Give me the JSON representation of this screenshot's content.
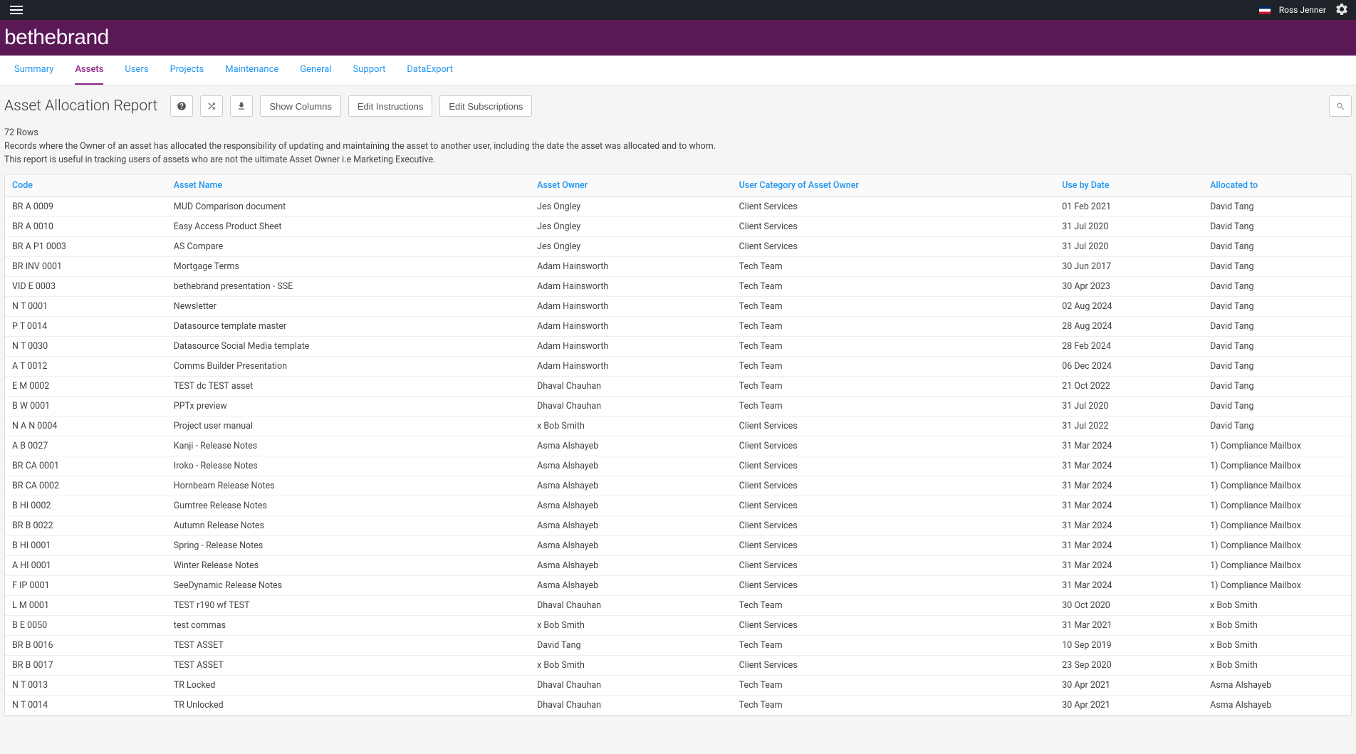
{
  "topbar": {
    "user_name": "Ross Jenner"
  },
  "brand": {
    "logo_text_1": "be",
    "logo_text_2": "the",
    "logo_text_3": "brand"
  },
  "tabs": [
    {
      "label": "Summary",
      "active": false
    },
    {
      "label": "Assets",
      "active": true
    },
    {
      "label": "Users",
      "active": false
    },
    {
      "label": "Projects",
      "active": false
    },
    {
      "label": "Maintenance",
      "active": false
    },
    {
      "label": "General",
      "active": false
    },
    {
      "label": "Support",
      "active": false
    },
    {
      "label": "DataExport",
      "active": false
    }
  ],
  "page": {
    "title": "Asset Allocation Report",
    "btn_show_columns": "Show Columns",
    "btn_edit_instructions": "Edit Instructions",
    "btn_edit_subscriptions": "Edit Subscriptions"
  },
  "meta": {
    "row_count": "72 Rows",
    "desc_line1": "Records where the Owner of an asset has allocated the responsibility of updating and maintaining the asset to another user, including the date the asset was allocated and to whom.",
    "desc_line2": "This report is useful in tracking users of assets who are not the ultimate Asset Owner i.e Marketing Executive."
  },
  "table": {
    "headers": {
      "code": "Code",
      "asset_name": "Asset Name",
      "asset_owner": "Asset Owner",
      "user_category": "User Category of Asset Owner",
      "use_by_date": "Use by Date",
      "allocated_to": "Allocated to"
    },
    "rows": [
      {
        "code": "BR A 0009",
        "name": "MUD Comparison document",
        "owner": "Jes Ongley",
        "category": "Client Services",
        "date": "01 Feb 2021",
        "allocated": "David Tang"
      },
      {
        "code": "BR A 0010",
        "name": "Easy Access Product Sheet",
        "owner": "Jes Ongley",
        "category": "Client Services",
        "date": "31 Jul 2020",
        "allocated": "David Tang"
      },
      {
        "code": "BR A P1 0003",
        "name": "AS Compare",
        "owner": "Jes Ongley",
        "category": "Client Services",
        "date": "31 Jul 2020",
        "allocated": "David Tang"
      },
      {
        "code": "BR INV 0001",
        "name": "Mortgage Terms",
        "owner": "Adam Hainsworth",
        "category": "Tech Team",
        "date": "30 Jun 2017",
        "allocated": "David Tang"
      },
      {
        "code": "VID E 0003",
        "name": "bethebrand presentation - SSE",
        "owner": "Adam Hainsworth",
        "category": "Tech Team",
        "date": "30 Apr 2023",
        "allocated": "David Tang"
      },
      {
        "code": "N T 0001",
        "name": "Newsletter",
        "owner": "Adam Hainsworth",
        "category": "Tech Team",
        "date": "02 Aug 2024",
        "allocated": "David Tang"
      },
      {
        "code": "P T 0014",
        "name": "Datasource template master",
        "owner": "Adam Hainsworth",
        "category": "Tech Team",
        "date": "28 Aug 2024",
        "allocated": "David Tang"
      },
      {
        "code": "N T 0030",
        "name": "Datasource Social Media template",
        "owner": "Adam Hainsworth",
        "category": "Tech Team",
        "date": "28 Feb 2024",
        "allocated": "David Tang"
      },
      {
        "code": "A T 0012",
        "name": "Comms Builder Presentation",
        "owner": "Adam Hainsworth",
        "category": "Tech Team",
        "date": "06 Dec 2024",
        "allocated": "David Tang"
      },
      {
        "code": "E M 0002",
        "name": "TEST dc TEST asset",
        "owner": "Dhaval Chauhan",
        "category": "Tech Team",
        "date": "21 Oct 2022",
        "allocated": "David Tang"
      },
      {
        "code": "B W 0001",
        "name": "PPTx preview",
        "owner": "Dhaval Chauhan",
        "category": "Tech Team",
        "date": "31 Jul 2020",
        "allocated": "David Tang"
      },
      {
        "code": "N A N 0004",
        "name": "Project user manual",
        "owner": "x Bob Smith",
        "category": "Client Services",
        "date": "31 Jul 2022",
        "allocated": "David Tang"
      },
      {
        "code": "A B 0027",
        "name": "Kanji - Release Notes",
        "owner": "Asma Alshayeb",
        "category": "Client Services",
        "date": "31 Mar 2024",
        "allocated": "1) Compliance Mailbox"
      },
      {
        "code": "BR CA 0001",
        "name": "Iroko - Release Notes",
        "owner": "Asma Alshayeb",
        "category": "Client Services",
        "date": "31 Mar 2024",
        "allocated": "1) Compliance Mailbox"
      },
      {
        "code": "BR CA 0002",
        "name": "Hornbeam Release Notes",
        "owner": "Asma Alshayeb",
        "category": "Client Services",
        "date": "31 Mar 2024",
        "allocated": "1) Compliance Mailbox"
      },
      {
        "code": "B HI 0002",
        "name": "Gumtree Release Notes",
        "owner": "Asma Alshayeb",
        "category": "Client Services",
        "date": "31 Mar 2024",
        "allocated": "1) Compliance Mailbox"
      },
      {
        "code": "BR B 0022",
        "name": "Autumn Release Notes",
        "owner": "Asma Alshayeb",
        "category": "Client Services",
        "date": "31 Mar 2024",
        "allocated": "1) Compliance Mailbox"
      },
      {
        "code": "B HI 0001",
        "name": "Spring - Release Notes",
        "owner": "Asma Alshayeb",
        "category": "Client Services",
        "date": "31 Mar 2024",
        "allocated": "1) Compliance Mailbox"
      },
      {
        "code": "A HI 0001",
        "name": "Winter Release Notes",
        "owner": "Asma Alshayeb",
        "category": "Client Services",
        "date": "31 Mar 2024",
        "allocated": "1) Compliance Mailbox"
      },
      {
        "code": "F IP 0001",
        "name": "SeeDynamic Release Notes",
        "owner": "Asma Alshayeb",
        "category": "Client Services",
        "date": "31 Mar 2024",
        "allocated": "1) Compliance Mailbox"
      },
      {
        "code": "L M 0001",
        "name": "TEST r190 wf TEST",
        "owner": "Dhaval Chauhan",
        "category": "Tech Team",
        "date": "30 Oct 2020",
        "allocated": "x Bob Smith"
      },
      {
        "code": "B E 0050",
        "name": "test commas",
        "owner": "x Bob Smith",
        "category": "Client Services",
        "date": "31 Mar 2021",
        "allocated": "x Bob Smith"
      },
      {
        "code": "BR B 0016",
        "name": "TEST ASSET",
        "owner": "David Tang",
        "category": "Tech Team",
        "date": "10 Sep 2019",
        "allocated": "x Bob Smith"
      },
      {
        "code": "BR B 0017",
        "name": "TEST ASSET",
        "owner": "x Bob Smith",
        "category": "Client Services",
        "date": "23 Sep 2020",
        "allocated": "x Bob Smith"
      },
      {
        "code": "N T 0013",
        "name": "TR Locked",
        "owner": "Dhaval Chauhan",
        "category": "Tech Team",
        "date": "30 Apr 2021",
        "allocated": "Asma Alshayeb"
      },
      {
        "code": "N T 0014",
        "name": "TR Unlocked",
        "owner": "Dhaval Chauhan",
        "category": "Tech Team",
        "date": "30 Apr 2021",
        "allocated": "Asma Alshayeb"
      }
    ]
  }
}
